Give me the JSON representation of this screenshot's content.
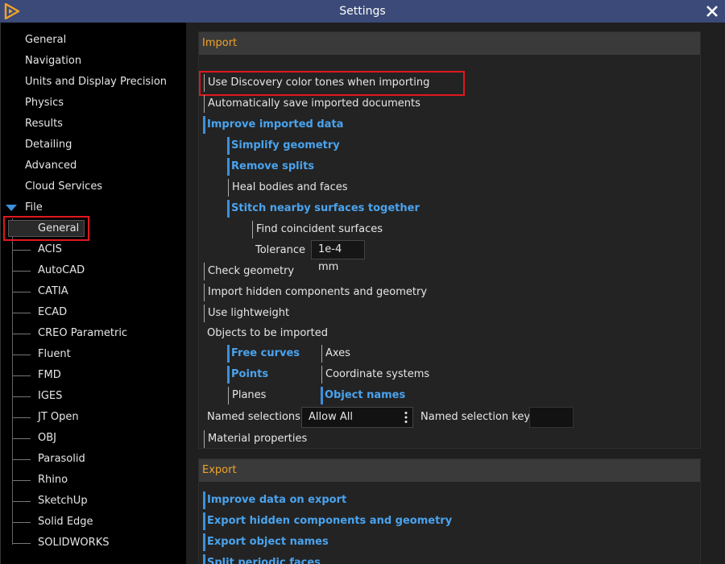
{
  "window": {
    "title": "Settings",
    "accent": "#3b4a78"
  },
  "icons": {
    "logo": "discovery-logo-icon",
    "close": "close-icon",
    "expand": "caret-down-icon",
    "menu": "kebab-menu-icon"
  },
  "colors": {
    "selection_box": "#e0181f",
    "enabled_blue": "#3d8fd9",
    "section_header": "#f0a32a"
  },
  "sidebar": {
    "top_items": [
      {
        "label": "General"
      },
      {
        "label": "Navigation"
      },
      {
        "label": "Units and Display Precision"
      },
      {
        "label": "Physics"
      },
      {
        "label": "Results"
      },
      {
        "label": "Detailing"
      },
      {
        "label": "Advanced"
      },
      {
        "label": "Cloud Services"
      }
    ],
    "file": {
      "label": "File",
      "children": [
        {
          "label": "General",
          "selected": true
        },
        {
          "label": "ACIS"
        },
        {
          "label": "AutoCAD"
        },
        {
          "label": "CATIA"
        },
        {
          "label": "ECAD"
        },
        {
          "label": "CREO Parametric"
        },
        {
          "label": "Fluent"
        },
        {
          "label": "FMD"
        },
        {
          "label": "IGES"
        },
        {
          "label": "JT Open"
        },
        {
          "label": "OBJ"
        },
        {
          "label": "Parasolid"
        },
        {
          "label": "Rhino"
        },
        {
          "label": "SketchUp"
        },
        {
          "label": "Solid Edge"
        },
        {
          "label": "SOLIDWORKS"
        }
      ]
    }
  },
  "import": {
    "header": "Import",
    "use_color_tones": "Use Discovery color tones when importing",
    "auto_save": "Automatically save imported documents",
    "improve": "Improve imported data",
    "simplify": "Simplify geometry",
    "remove_splits": "Remove splits",
    "heal": "Heal bodies and faces",
    "stitch": "Stitch nearby surfaces together",
    "find_coincident": "Find coincident surfaces",
    "tolerance_label": "Tolerance",
    "tolerance_value": "1e-4 mm",
    "check_geometry": "Check geometry",
    "import_hidden": "Import hidden components and geometry",
    "use_lightweight": "Use lightweight",
    "objects_label": "Objects to be imported",
    "free_curves": "Free curves",
    "axes": "Axes",
    "points": "Points",
    "coordinate_systems": "Coordinate systems",
    "planes": "Planes",
    "object_names": "Object names",
    "named_selections_label": "Named selections",
    "named_selections_value": "Allow All",
    "named_selection_key_label": "Named selection key",
    "material_properties": "Material properties"
  },
  "export": {
    "header": "Export",
    "improve": "Improve data on export",
    "hidden": "Export hidden components and geometry",
    "object_names": "Export object names",
    "split_periodic": "Split periodic faces"
  }
}
